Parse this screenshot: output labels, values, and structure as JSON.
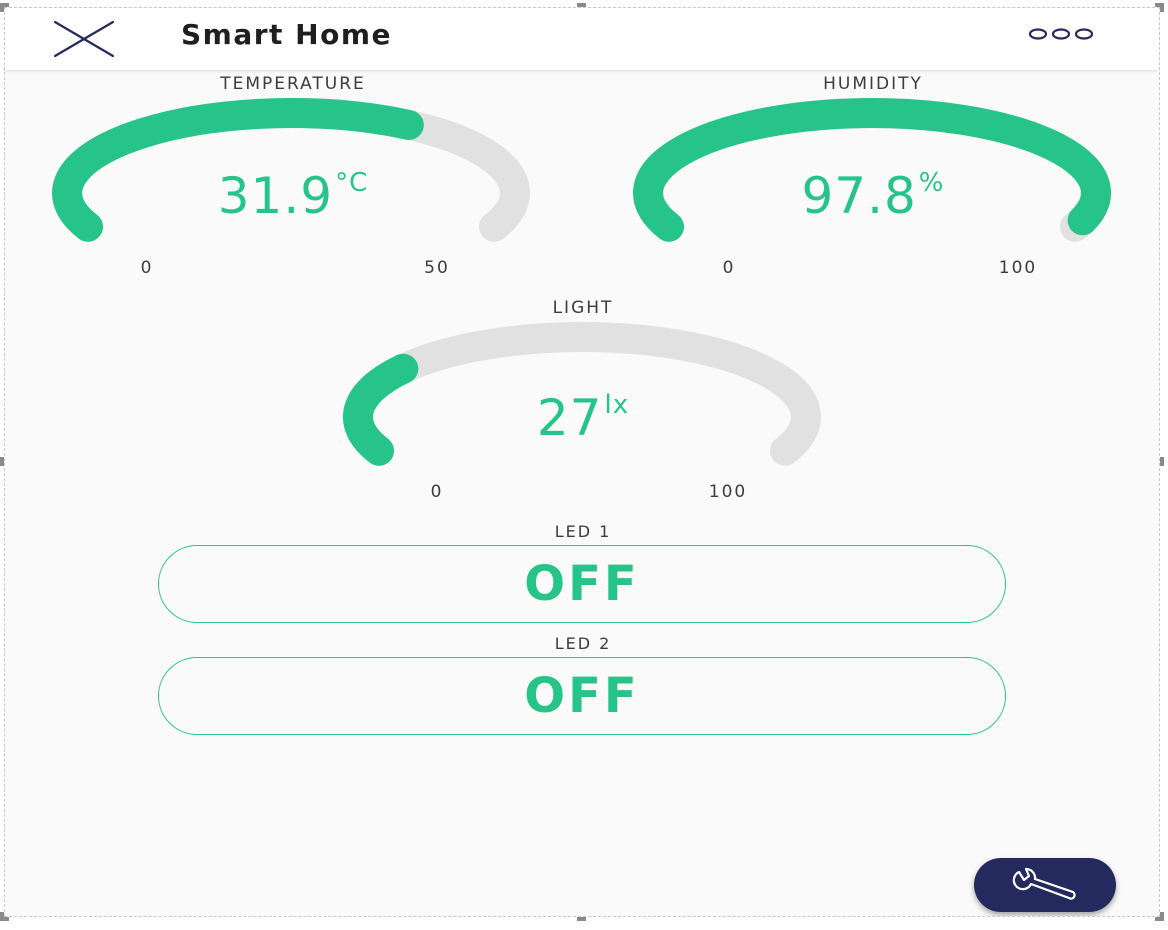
{
  "app": {
    "title": "Smart Home",
    "close_icon": "close-icon",
    "more_icon": "more-horizontal-icon"
  },
  "colors": {
    "accent": "#26c48b",
    "track": "#e1e1e1",
    "fab": "#252a5e",
    "background": "#fafafa"
  },
  "gauges": [
    {
      "key": "temperature",
      "label": "TEMPERATURE",
      "value": 31.9,
      "value_text": "31.9",
      "unit": "°C",
      "min": 0,
      "max": 50,
      "min_label": "0",
      "max_label": "50"
    },
    {
      "key": "humidity",
      "label": "HUMIDITY",
      "value": 97.8,
      "value_text": "97.8",
      "unit": "%",
      "min": 0,
      "max": 100,
      "min_label": "0",
      "max_label": "100"
    },
    {
      "key": "light",
      "label": "LIGHT",
      "value": 27,
      "value_text": "27",
      "unit": "lx",
      "min": 0,
      "max": 100,
      "min_label": "0",
      "max_label": "100"
    }
  ],
  "leds": [
    {
      "label": "LED 1",
      "state": "OFF"
    },
    {
      "label": "LED 2",
      "state": "OFF"
    }
  ],
  "fab": {
    "icon": "wrench-icon"
  }
}
